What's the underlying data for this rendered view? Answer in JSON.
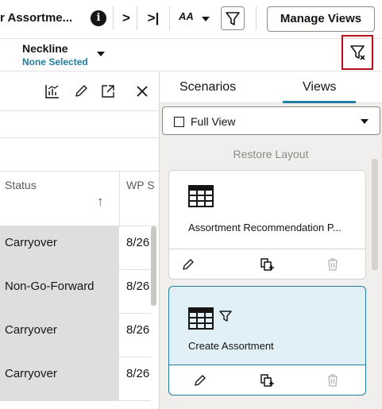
{
  "toolbar": {
    "tab_title": "r Assortme...",
    "info_glyph": "i",
    "next_glyph": ">",
    "last_glyph": ">|",
    "font_size_label": "AA",
    "manage_views_label": "Manage Views"
  },
  "filter": {
    "label": "Neckline",
    "value": "None Selected"
  },
  "grid": {
    "columns": [
      "Status",
      "WP S"
    ],
    "sort_glyph": "↑",
    "rows": [
      {
        "status": "Carryover",
        "wp": "8/26"
      },
      {
        "status": "Non-Go-Forward",
        "wp": "8/26"
      },
      {
        "status": "Carryover",
        "wp": "8/26"
      },
      {
        "status": "Carryover",
        "wp": "8/26"
      }
    ]
  },
  "views_panel": {
    "tabs": [
      "Scenarios",
      "Views"
    ],
    "active_tab": "Views",
    "selected_view": "Full View",
    "restore_label": "Restore Layout",
    "cards": [
      {
        "name": "Assortment Recommendation P...",
        "filtered": false,
        "active": false
      },
      {
        "name": "Create Assortment",
        "filtered": true,
        "active": true
      }
    ]
  },
  "colors": {
    "accent": "#227e9e",
    "highlight_border": "#b3101a",
    "active_card_bg": "#e0f0f6",
    "row_shade": "#dedede"
  },
  "icons": {
    "toolbar": [
      "info-icon",
      "chevron-right-icon",
      "last-page-icon",
      "font-size-icon",
      "filter-icon"
    ],
    "grid_toolbar": [
      "chart-icon",
      "edit-icon",
      "expand-icon",
      "close-icon"
    ],
    "card_actions": [
      "edit-icon",
      "duplicate-icon",
      "delete-icon"
    ]
  }
}
